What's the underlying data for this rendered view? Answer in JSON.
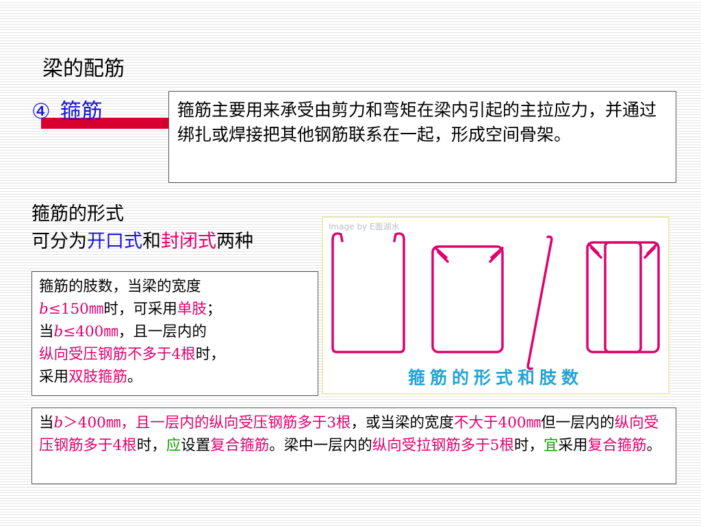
{
  "slide": {
    "title": "梁的配筋"
  },
  "section": {
    "number": "④",
    "label": "箍筋"
  },
  "definition": {
    "text": "箍筋主要用来承受由剪力和弯矩在梁内引起的主拉应力，并通过绑扎或焊接把其他钢筋联系在一起，形成空间骨架。"
  },
  "forms": {
    "line1": "箍筋的形式",
    "line2_prefix": "可分为",
    "open_type": "开口式",
    "conjunction": "和",
    "closed_type": "封闭式",
    "line2_suffix": "两种"
  },
  "figure": {
    "watermark": "Image by  E面湖水",
    "caption": "箍筋的形式和肢数",
    "stroke_color": "#e0006e",
    "caption_color": "#23a3d4"
  },
  "legs": {
    "l1": "箍筋的肢数，当梁的宽度",
    "l2_var": "b",
    "l2_cond": "≤150㎜",
    "l2_mid": "时，可采用",
    "l2_red": "单肢",
    "l2_end": "；",
    "l3_pre": "当",
    "l3_var": "b",
    "l3_cond": "≤400㎜",
    "l3_end": "，且一层内的",
    "l4_red": "纵向受压钢筋不多于4根",
    "l4_end": "时，",
    "l5_pre": "采用",
    "l5_red": "双肢箍筋",
    "l5_end": "。"
  },
  "composite": {
    "s1": "当",
    "s1_var": "b",
    "s2": "＞400㎜，且一层内的",
    "r1": "纵向受压钢筋多于3根",
    "s3": "，或当梁的宽度",
    "r2": "不大于400㎜",
    "s4": "但一层内的",
    "r3": "纵向受压钢筋多于4根",
    "s5": "时，",
    "g1": "应",
    "s6": "设置",
    "r4": "复合箍筋",
    "s7": "。梁中一层内的",
    "r5": "纵向受拉钢筋多于5根",
    "s8": "时，",
    "g2": "宜",
    "s9": "采用",
    "r6": "复合箍筋",
    "s10": "。"
  },
  "colors": {
    "heading_blue": "#1a14d8",
    "emphasis_red": "#e0006e",
    "emphasis_green": "#119b00",
    "bar_red": "#d6002e"
  }
}
